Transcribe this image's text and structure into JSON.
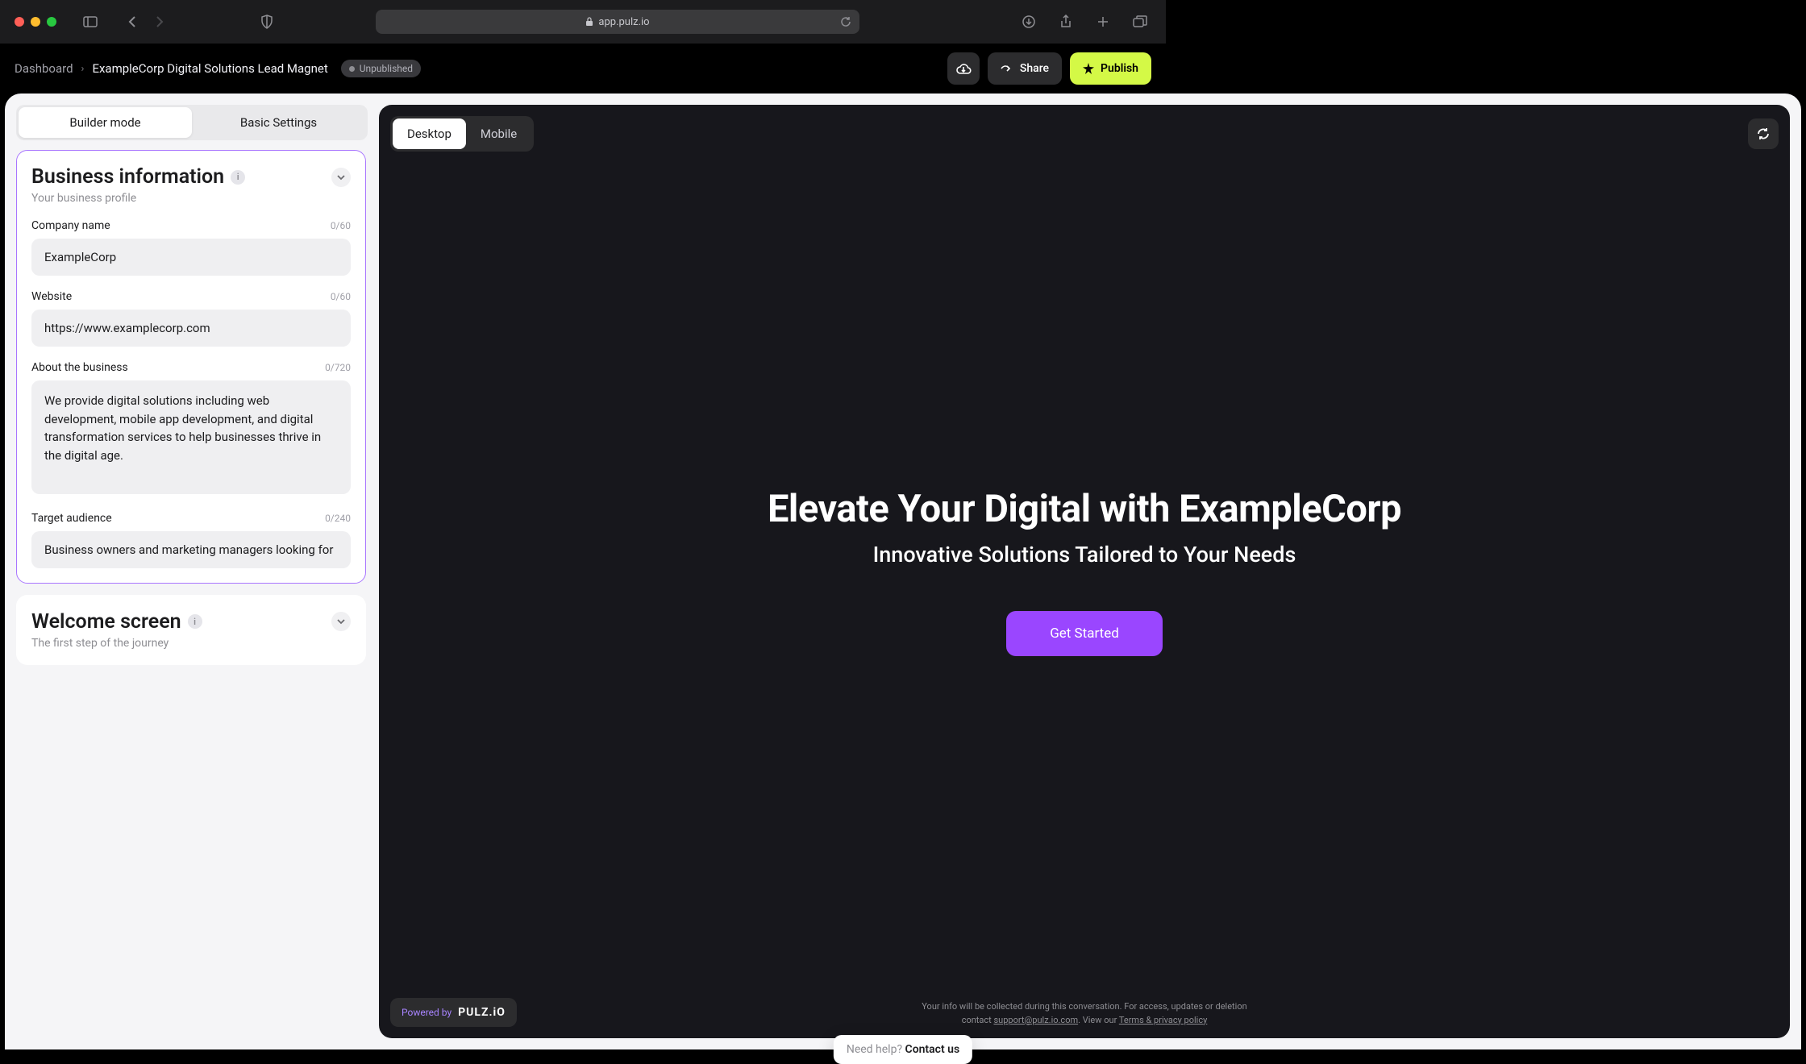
{
  "browser": {
    "url": "app.pulz.io"
  },
  "breadcrumb": {
    "root": "Dashboard",
    "page_title": "ExampleCorp Digital Solutions Lead Magnet",
    "status": "Unpublished"
  },
  "header_actions": {
    "share": "Share",
    "publish": "Publish"
  },
  "mode_tabs": {
    "builder": "Builder mode",
    "settings": "Basic Settings"
  },
  "sections": {
    "business_info": {
      "title": "Business information",
      "subtitle": "Your business profile",
      "fields": {
        "company_name": {
          "label": "Company name",
          "counter": "0/60",
          "value": "ExampleCorp"
        },
        "website": {
          "label": "Website",
          "counter": "0/60",
          "value": "https://www.examplecorp.com"
        },
        "about": {
          "label": "About the business",
          "counter": "0/720",
          "value": "We provide digital solutions including web development, mobile app development, and digital transformation services to help businesses thrive in the digital age."
        },
        "target_audience": {
          "label": "Target audience",
          "counter": "0/240",
          "value": "Business owners and marketing managers looking for"
        }
      }
    },
    "welcome_screen": {
      "title": "Welcome screen",
      "subtitle": "The first step of the journey"
    }
  },
  "preview": {
    "device_tabs": {
      "desktop": "Desktop",
      "mobile": "Mobile"
    },
    "heading": "Elevate Your Digital with ExampleCorp",
    "subheading": "Innovative Solutions Tailored to Your Needs",
    "cta": "Get Started",
    "powered_by_label": "Powered by",
    "powered_by_brand": "PULZ.iO",
    "footer_line1": "Your info will be collected during this conversation. For access, updates or deletion contact ",
    "footer_email": "support@pulz.io.com",
    "footer_line2": ". View our ",
    "footer_terms": "Terms & privacy policy"
  },
  "help": {
    "prompt": "Need help? ",
    "link": "Contact us"
  }
}
